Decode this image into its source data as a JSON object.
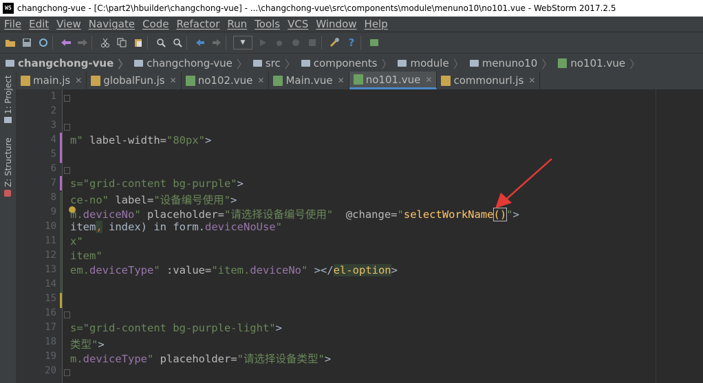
{
  "window": {
    "title": "changchong-vue - [C:\\part2\\hbuilder\\changchong-vue] - ...\\changchong-vue\\src\\components\\module\\menuno10\\no101.vue - WebStorm 2017.2.5",
    "logo_text": "WS"
  },
  "menu": [
    "File",
    "Edit",
    "View",
    "Navigate",
    "Code",
    "Refactor",
    "Run",
    "Tools",
    "VCS",
    "Window",
    "Help"
  ],
  "toolbar": {
    "icons": [
      "open-folder-icon",
      "save-icon",
      "sync-icon",
      "undo-icon",
      "redo-icon",
      "cut-icon",
      "copy-icon",
      "paste-icon",
      "find-icon",
      "replace-icon",
      "back-icon",
      "forward-icon",
      "run-config-combo",
      "run-icon",
      "debug-icon",
      "coverage-icon",
      "stop-icon",
      "settings-icon",
      "help-icon",
      "terminal-icon"
    ]
  },
  "breadcrumbs": [
    "changchong-vue",
    "changchong-vue",
    "src",
    "components",
    "module",
    "menuno10",
    "no101.vue"
  ],
  "tabs": [
    {
      "label": "main.js",
      "type": "js",
      "active": false
    },
    {
      "label": "globalFun.js",
      "type": "js",
      "active": false
    },
    {
      "label": "no102.vue",
      "type": "vue",
      "active": false
    },
    {
      "label": "Main.vue",
      "type": "vue",
      "active": false
    },
    {
      "label": "no101.vue",
      "type": "vue",
      "active": true
    },
    {
      "label": "commonurl.js",
      "type": "js",
      "active": false
    }
  ],
  "sidebar": {
    "project_label": "1: Project",
    "structure_label": "Z: Structure"
  },
  "editor": {
    "line_numbers": [
      "1",
      "2",
      "3",
      "4",
      "5",
      "6",
      "7",
      "8",
      "9",
      "10",
      "11",
      "12",
      "13",
      "14",
      "15",
      "16",
      "17",
      "18",
      "19",
      "20"
    ],
    "lines": {
      "l4a": "m\"",
      "l4b": " label-width=",
      "l4c": "\"80px\"",
      "l4d": ">",
      "l7a": "s=\"grid-content bg-purple\"",
      "l7b": ">",
      "l8a": "ce-no\"",
      "l8b": " label=",
      "l8c": "\"设备编号使用\"",
      "l8d": ">",
      "l9a": "m.",
      "l9b": "deviceNo",
      "l9c": "\"",
      "l9d": " placeholder=",
      "l9e": "\"请选择设备编号使用\"",
      "l9f": "  ",
      "l9g": "@change",
      "l9h": "=",
      "l9i": "\"",
      "l9j": "selectWorkName",
      "l9k": "()",
      "l9l": "\"",
      "l9m": ">",
      "l10a": "item",
      "l10b": ",",
      "l10c": " index) ",
      "l10d": "in",
      "l10e": " form.",
      "l10f": "deviceNoUse",
      "l10g": "\"",
      "l11": "x\"",
      "l12": "item\"",
      "l13a": "em.",
      "l13b": "deviceType",
      "l13c": "\"",
      "l13d": " :value=",
      "l13e": "\"item.",
      "l13f": "deviceNo",
      "l13g": "\"",
      "l13h": " ></",
      "l13i": "el-option",
      "l13j": ">",
      "l17a": "s=\"grid-content bg-purple-light\"",
      "l17b": ">",
      "l18a": "类型\"",
      "l18b": ">",
      "l19a": "m.",
      "l19b": "deviceType",
      "l19c": "\"",
      "l19d": " placeholder=",
      "l19e": "\"请选择设备类型\"",
      "l19f": ">"
    }
  },
  "colors": {
    "editor_bg": "#2b2b2b",
    "annotation_arrow": "#e53935",
    "string": "#6a8759",
    "field": "#9876aa",
    "function": "#ffc66d"
  }
}
